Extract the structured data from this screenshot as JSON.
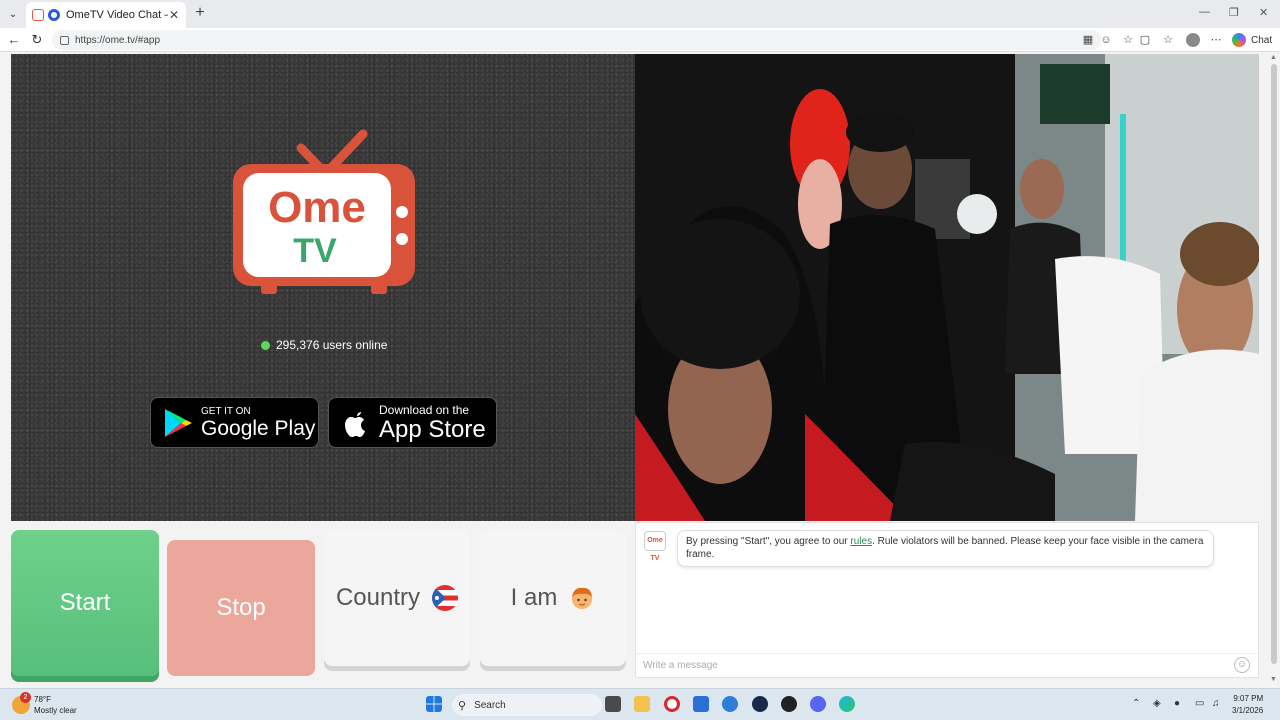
{
  "browser": {
    "tab_title": "OmeTV Video Chat — Omegle",
    "url": "https://ome.tv/#app",
    "chat_label": "Chat",
    "new_tab_symbol": "+",
    "tab_close_symbol": "✕"
  },
  "hero": {
    "logo_top": "Ome",
    "logo_bottom": "TV",
    "users_online": "295,376 users online",
    "google_play": {
      "small": "GET IT ON",
      "big": "Google Play"
    },
    "app_store": {
      "small": "Download on the",
      "big": "App Store"
    }
  },
  "controls": {
    "start": "Start",
    "stop": "Stop",
    "country": "Country",
    "i_am": "I am"
  },
  "chat": {
    "avatar_text": "Ome TV",
    "message_before": "By pressing \"Start\", you agree to our ",
    "rules_link": "rules",
    "message_after": ". Rule violators will be banned. Please keep your face visible in the camera frame.",
    "input_placeholder": "Write a message"
  },
  "taskbar": {
    "temp": "78°F",
    "condition": "Mostly clear",
    "weather_badge": "2",
    "search_label": "Search",
    "time": "9:07 PM",
    "date": "3/1/2026"
  },
  "colors": {
    "brand_red": "#d9533a",
    "brand_green": "#2e8b57",
    "start_green": "#5ac47d",
    "stop_pink": "#eca79c"
  },
  "icons": [
    "tab-list-icon",
    "back-icon",
    "refresh-icon",
    "lock-icon",
    "split-icon",
    "reader-icon",
    "favorite-icon",
    "collections-icon",
    "media-icon",
    "profile-icon",
    "more-icon",
    "copilot-icon",
    "emoji-icon",
    "windows-icon",
    "search-icon",
    "file-explorer-icon",
    "opera-icon",
    "store-icon",
    "discord-icon",
    "edge-icon",
    "wifi-icon",
    "volume-icon",
    "battery-icon"
  ]
}
